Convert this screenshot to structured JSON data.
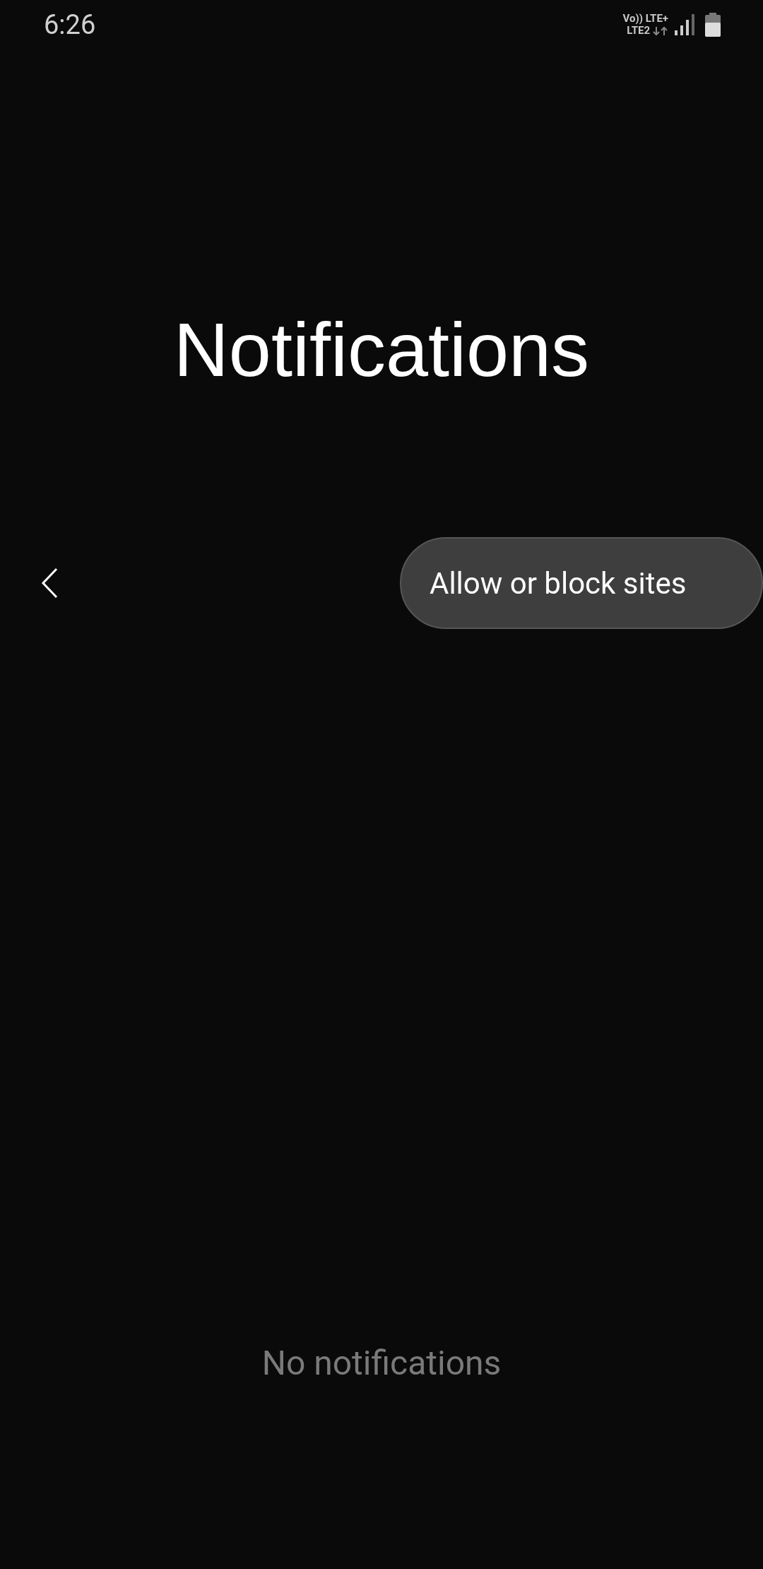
{
  "status_bar": {
    "time": "6:26",
    "network_top": "Vo)) LTE+",
    "network_bottom": "LTE2"
  },
  "title": "Notifications",
  "toolbar": {
    "button": "Allow or block sites"
  },
  "empty_message": "No notifications"
}
